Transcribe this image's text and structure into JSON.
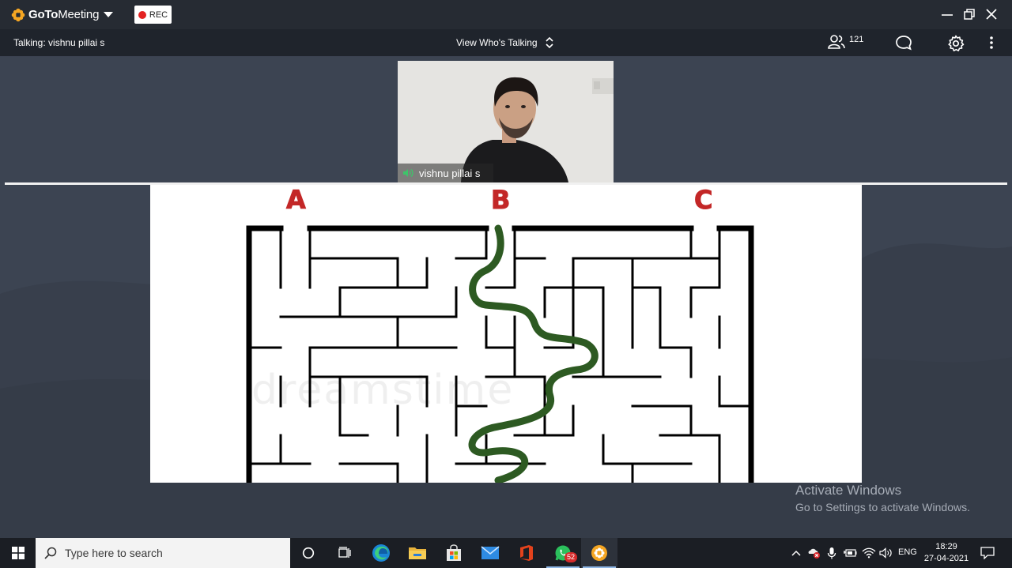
{
  "window": {
    "brand_bold": "GoTo",
    "brand_light": "Meeting",
    "rec_label": "REC"
  },
  "infobar": {
    "talking": "Talking: vishnu pillai s",
    "view_who": "View Who's Talking",
    "participant_count": "121"
  },
  "camera": {
    "name": "vishnu pillai s"
  },
  "shared_screen": {
    "maze_labels": [
      "A",
      "B",
      "C"
    ],
    "watermark": "dreamstime"
  },
  "activation": {
    "title": "Activate Windows",
    "subtitle": "Go to Settings to activate Windows."
  },
  "taskbar": {
    "search_placeholder": "Type here to search",
    "whatsapp_badge": "52",
    "language": "ENG",
    "time": "18:29",
    "date": "27-04-2021"
  },
  "colors": {
    "accent_orange": "#f5a623",
    "rec_red": "#e32222",
    "maze_path_green": "#2d5a22",
    "maze_label_red": "#c32727"
  },
  "icons": [
    "gotomeeting-logo-icon",
    "chevron-down-icon",
    "record-dot-icon",
    "minimize-icon",
    "restore-icon",
    "close-icon",
    "updown-chevron-icon",
    "participants-icon",
    "chat-icon",
    "settings-gear-icon",
    "more-vertical-icon",
    "speaker-icon",
    "windows-start-icon",
    "search-icon",
    "cortana-icon",
    "task-view-icon",
    "edge-icon",
    "file-explorer-icon",
    "store-icon",
    "mail-icon",
    "office-icon",
    "whatsapp-icon",
    "gotomeeting-taskbar-icon",
    "chevron-up-icon",
    "antivirus-icon",
    "microphone-icon",
    "battery-icon",
    "wifi-icon",
    "volume-icon",
    "notification-icon"
  ]
}
